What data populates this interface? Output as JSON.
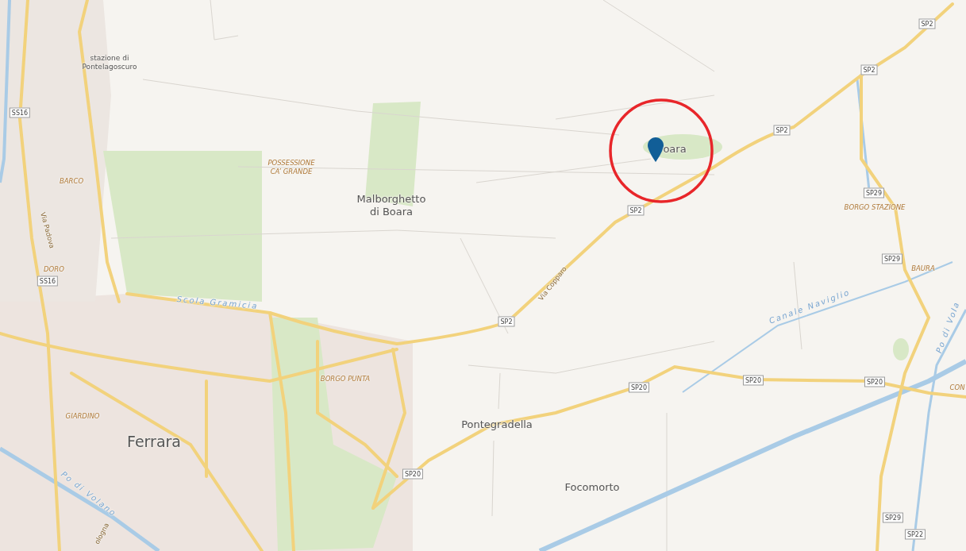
{
  "map": {
    "places": [
      {
        "text": "stazione di Pontelagoscuro",
        "kind": "station"
      },
      {
        "text": "Malborghetto di Boara",
        "kind": "village"
      },
      {
        "text": "oara",
        "kind": "village"
      },
      {
        "text": "Pontegradella",
        "kind": "village"
      },
      {
        "text": "Ferrara",
        "kind": "city"
      },
      {
        "text": "Focomorto",
        "kind": "village"
      }
    ],
    "localities": [
      "POSSESSIONE CA’ GRANDE",
      "BARCO",
      "BORGO STAZIONE",
      "BAURA",
      "DORO",
      "BORGO PUNTA",
      "CON",
      "GIARDINO"
    ],
    "road_shields": [
      "SP2",
      "SP2",
      "SS16",
      "SP2",
      "SP29",
      "SP2",
      "SP29",
      "SS16",
      "SP2",
      "SP20",
      "SP20",
      "SP20",
      "SP20",
      "SP29",
      "SP22"
    ],
    "water_labels": [
      "Scola Gramicia",
      "Canale Naviglio",
      "Po di Vola",
      "Po di Volano"
    ],
    "street_labels": [
      "Via Padova",
      "Via Copparo",
      "ologna"
    ]
  }
}
